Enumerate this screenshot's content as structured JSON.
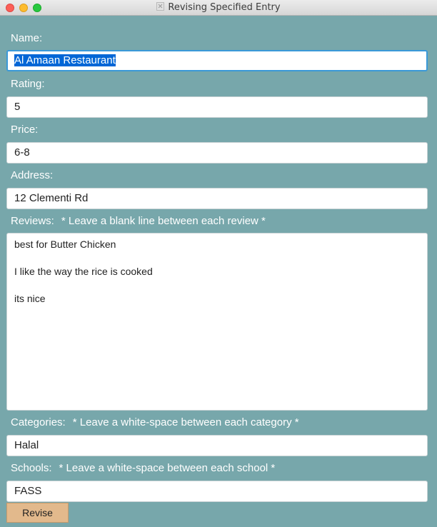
{
  "window": {
    "title": "Revising Specified Entry"
  },
  "form": {
    "name": {
      "label": "Name:",
      "value": "Al Amaan Restaurant"
    },
    "rating": {
      "label": "Rating:",
      "value": "5"
    },
    "price": {
      "label": "Price:",
      "value": "6-8"
    },
    "address": {
      "label": "Address:",
      "value": "12 Clementi Rd"
    },
    "reviews": {
      "label": "Reviews:",
      "hint": "* Leave a blank line between each review *",
      "items": [
        "best for Butter Chicken",
        "I like the way the rice is cooked",
        "its nice"
      ]
    },
    "categories": {
      "label": "Categories:",
      "hint": "* Leave a white-space between each category *",
      "value": "Halal"
    },
    "schools": {
      "label": "Schools:",
      "hint": "* Leave a white-space between each school *",
      "value": "FASS"
    }
  },
  "actions": {
    "revise_label": "Revise"
  },
  "colors": {
    "background": "#77a7ab",
    "button": "#e2b98c",
    "selection": "#0066d6",
    "focus": "#3a99d8"
  }
}
